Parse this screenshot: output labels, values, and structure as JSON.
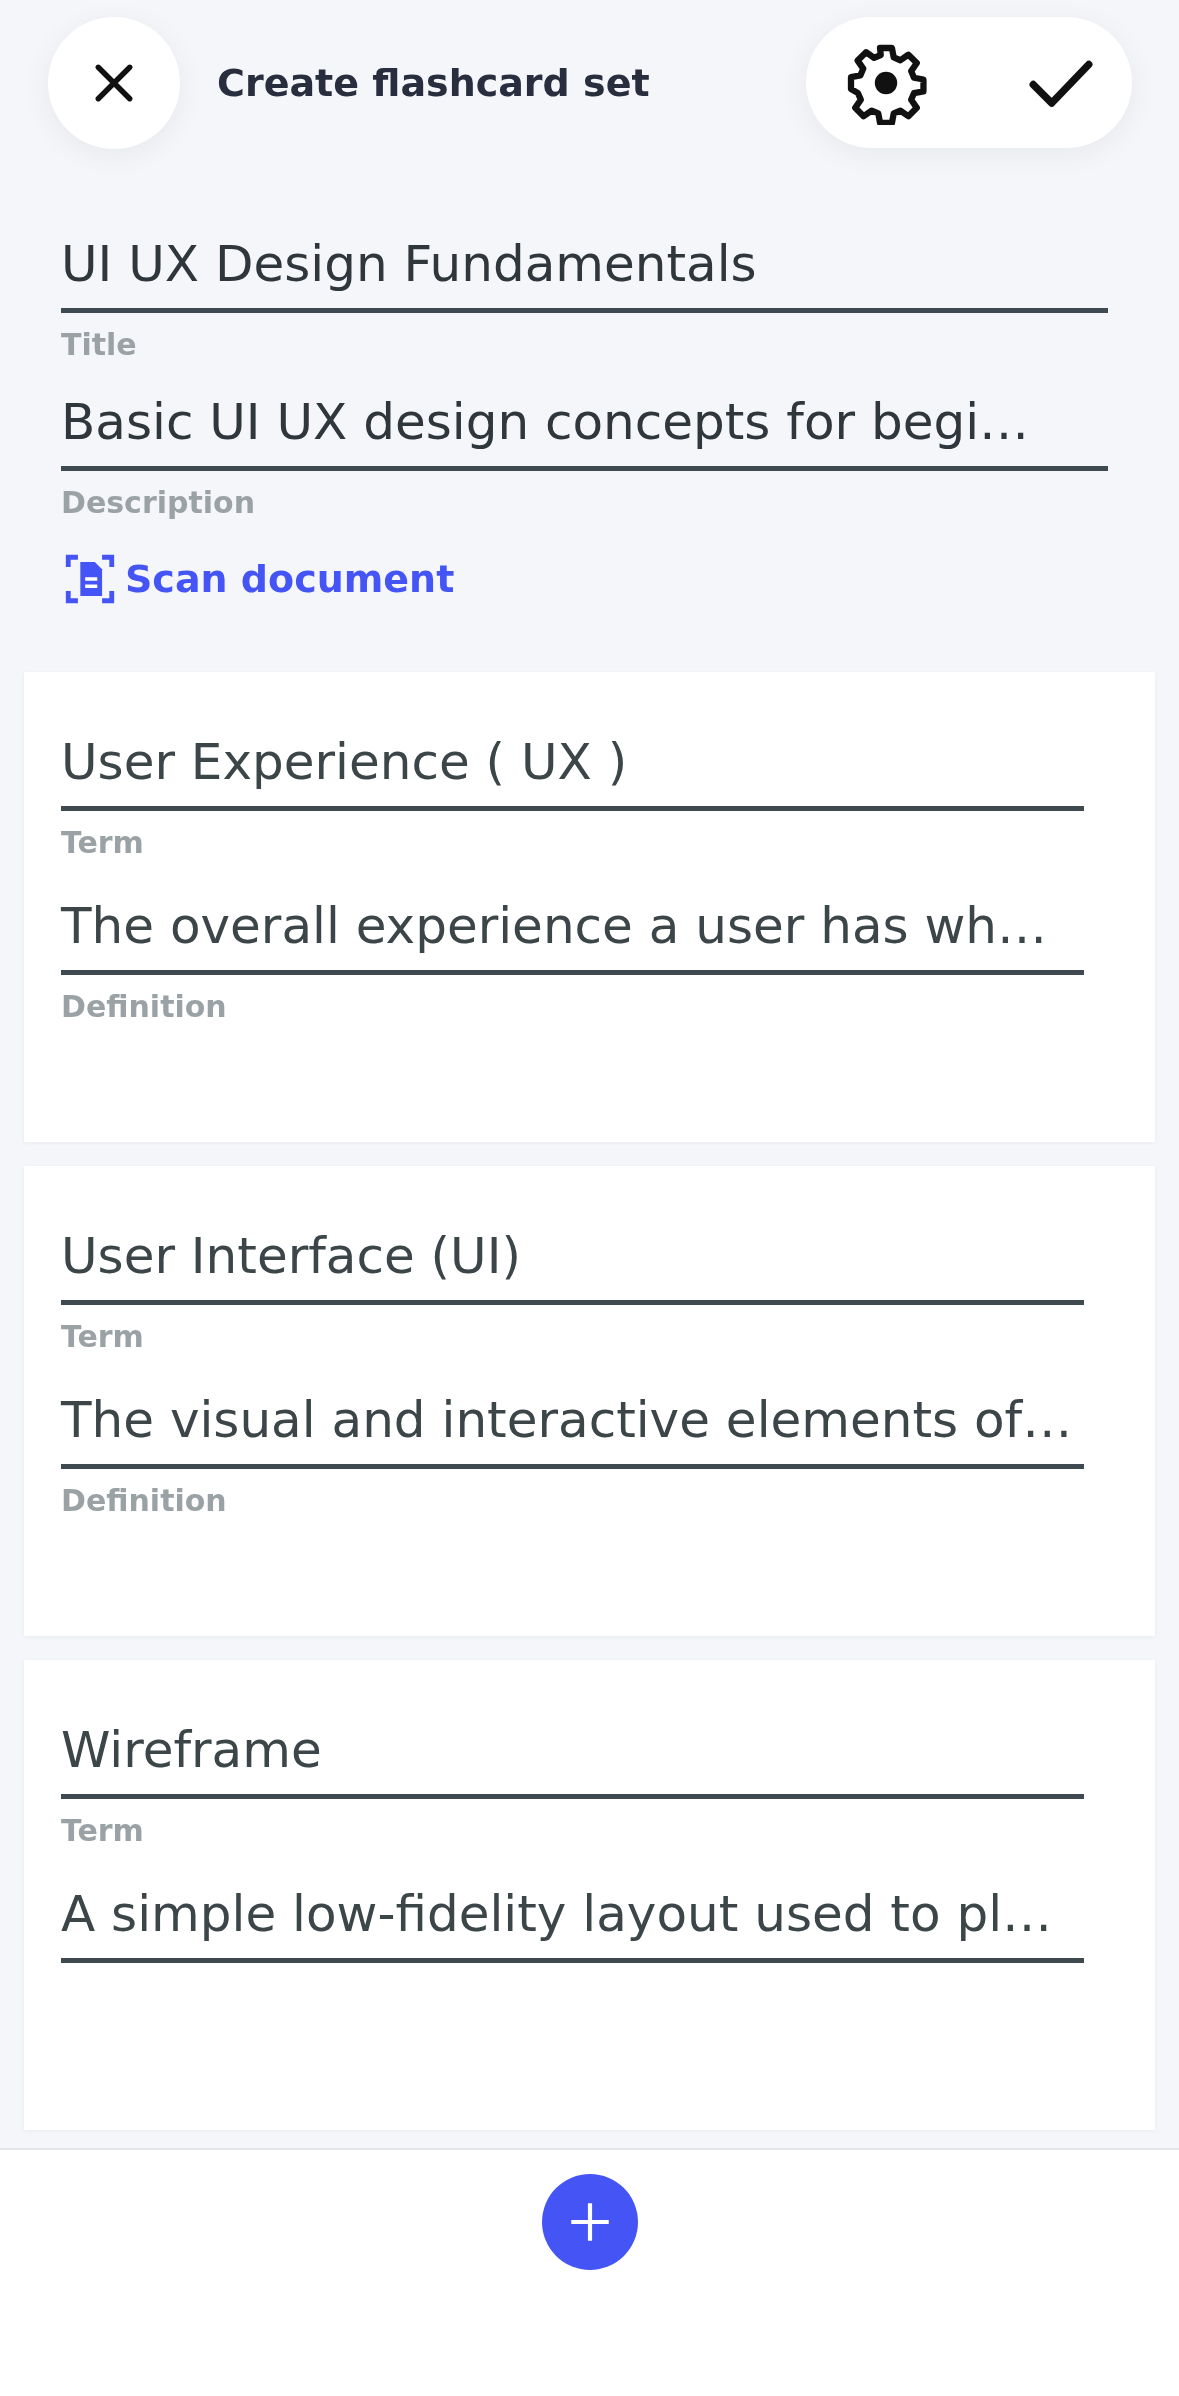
{
  "header": {
    "title": "Create flashcard set"
  },
  "set_fields": [
    {
      "value": "UI UX Design Fundamentals",
      "label": "Title"
    },
    {
      "value": "Basic UI UX design concepts for begi…",
      "label": "Description"
    }
  ],
  "scan_link": {
    "label": "Scan document"
  },
  "cards": [
    {
      "term": "User Experience ( UX )",
      "term_label": "Term",
      "definition": "The overall experience a user has wh…",
      "definition_label": "Definition"
    },
    {
      "term": "User Interface (UI)",
      "term_label": "Term",
      "definition": "The visual and interactive elements of…",
      "definition_label": "Definition"
    },
    {
      "term": "Wireframe",
      "term_label": "Term",
      "definition": "A simple low-fidelity layout used to pl…"
    }
  ]
}
